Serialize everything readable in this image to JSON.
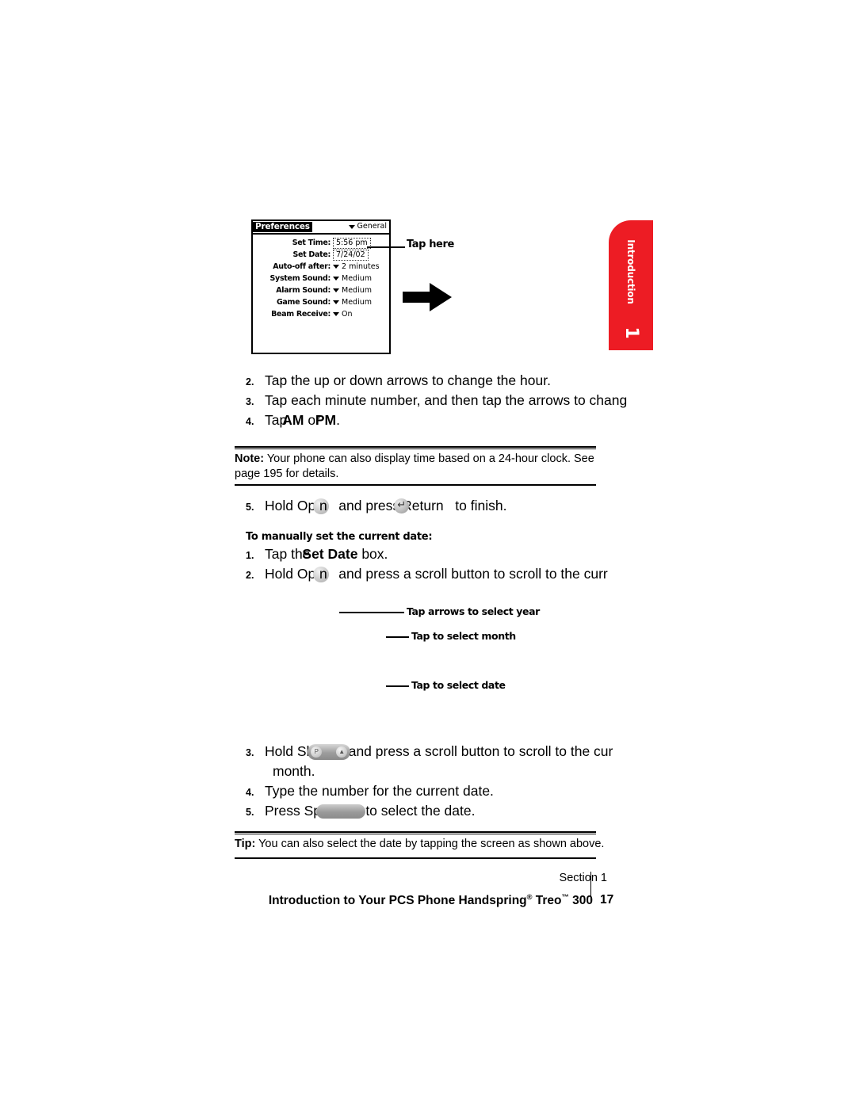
{
  "section_tab": {
    "label": "Introduction",
    "number": "1",
    "color": "#ED1C24"
  },
  "screenshot": {
    "app_title": "Preferences",
    "category": "General",
    "rows": [
      {
        "label": "Set Time:",
        "value": "5:56 pm",
        "type": "boxed"
      },
      {
        "label": "Set Date:",
        "value": "7/24/02",
        "type": "boxed"
      },
      {
        "label": "Auto-off after:",
        "value": "2 minutes",
        "type": "picker"
      },
      {
        "label": "System Sound:",
        "value": "Medium",
        "type": "picker"
      },
      {
        "label": "Alarm Sound:",
        "value": "Medium",
        "type": "picker"
      },
      {
        "label": "Game Sound:",
        "value": "Medium",
        "type": "picker"
      },
      {
        "label": "Beam Receive:",
        "value": "On",
        "type": "picker"
      }
    ],
    "tap_here_label": "Tap here"
  },
  "steps_time": [
    {
      "num": "2.",
      "text": "Tap the up or down arrows to change the hour."
    },
    {
      "num": "3.",
      "text": "Tap each minute number, and then tap the arrows to chang"
    }
  ],
  "step_ampm": {
    "num": "4.",
    "pre": "Tap",
    "am": "AM",
    "mid": "or",
    "pm": "PM",
    "post": "."
  },
  "note": {
    "label": "Note:",
    "text": " Your phone can also display time based on a 24-hour clock. See page 195 for details."
  },
  "step_finish": {
    "num": "5.",
    "part1": "Hold Opti",
    "part2": "n",
    "part3": "and press",
    "part4": "Return",
    "part5": "to finish."
  },
  "date_heading": "To manually set the current date:",
  "step_tap_box": {
    "num": "1.",
    "part1": "Tap the",
    "bold": "Set Date",
    "part2": "box."
  },
  "step_scroll_year": {
    "num": "2.",
    "part1": "Hold Opti",
    "part2": "n",
    "part3": "and press a scroll button to scroll to the curr"
  },
  "callouts": [
    {
      "label": "Tap arrows to select year"
    },
    {
      "label": "Tap to select month"
    },
    {
      "label": "Tap to select date"
    }
  ],
  "step_scroll_month": {
    "num": "3.",
    "part1": "Hold Sh",
    "part2": "and press a scroll button to scroll to the cur",
    "line2": "month.",
    "shift_p": "P"
  },
  "step_type_date": {
    "num": "4.",
    "text": "Type the number for the current date."
  },
  "step_press_space": {
    "num": "5.",
    "part1": "Press Sp",
    "part2": "to select the date."
  },
  "tip": {
    "label": "Tip:",
    "text": " You can also select the date by tapping the screen as shown above."
  },
  "footer": {
    "section": "Section 1",
    "title_pre": "Introduction to Your PCS Phone Handspring",
    "reg": "®",
    "title_mid": " Treo",
    "tm": "™",
    "title_post": " 300",
    "page": "17"
  }
}
